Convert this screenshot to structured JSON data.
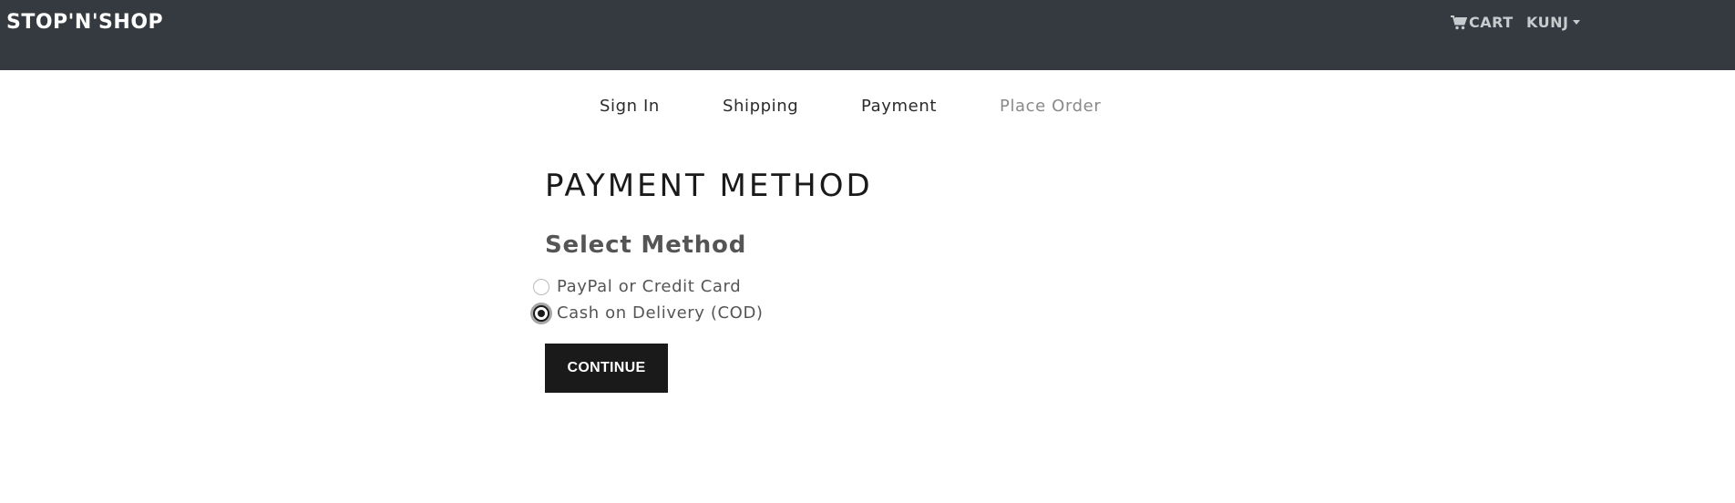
{
  "navbar": {
    "brand": "STOP'N'SHOP",
    "cart_label": "CART",
    "user_label": "KUNJ"
  },
  "steps": [
    {
      "label": "Sign In",
      "enabled": true
    },
    {
      "label": "Shipping",
      "enabled": true
    },
    {
      "label": "Payment",
      "enabled": true
    },
    {
      "label": "Place Order",
      "enabled": false
    }
  ],
  "main": {
    "title": "PAYMENT METHOD",
    "subtitle": "Select Method",
    "options": [
      {
        "label": "PayPal or Credit Card",
        "checked": false
      },
      {
        "label": "Cash on Delivery (COD)",
        "checked": true
      }
    ],
    "continue_label": "CONTINUE"
  },
  "colors": {
    "navbar_bg": "#343a40",
    "button_bg": "#1a1a1a",
    "disabled_step": "#8a8a8a"
  }
}
